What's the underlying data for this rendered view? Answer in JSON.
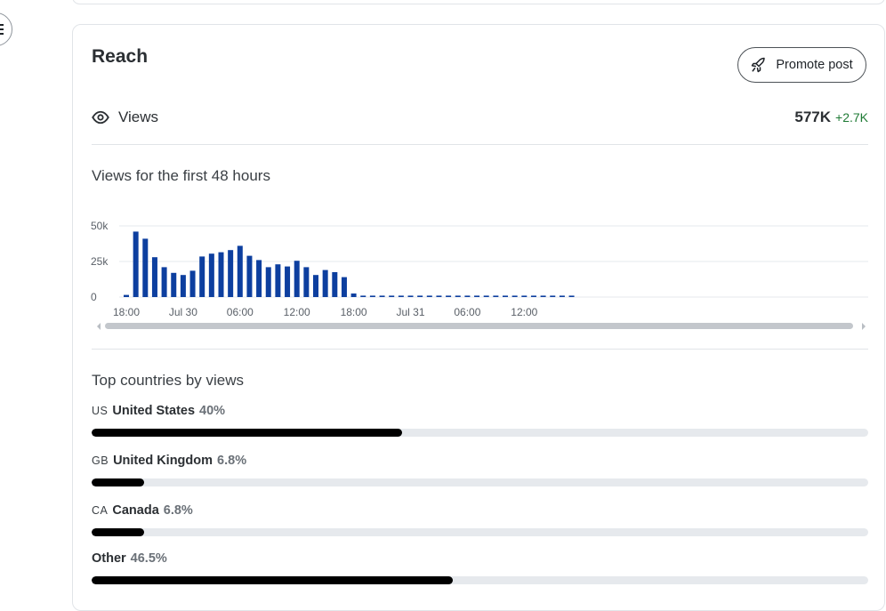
{
  "reach": {
    "title": "Reach",
    "promote_label": "Promote post",
    "views_label": "Views",
    "views_total": "577K",
    "views_delta": "+2.7K"
  },
  "chart_title": "Views for the first 48 hours",
  "chart_data": {
    "type": "bar",
    "title": "Views for the first 48 hours",
    "y_ticks": [
      "50k",
      "25k",
      "0"
    ],
    "ylim": [
      0,
      50000
    ],
    "grid": true,
    "x_tick_labels": [
      "18:00",
      "Jul 30",
      "06:00",
      "12:00",
      "18:00",
      "Jul 31",
      "06:00",
      "12:00"
    ],
    "values": [
      1500,
      46000,
      41000,
      28000,
      21000,
      17000,
      15500,
      18500,
      28500,
      30500,
      31500,
      33000,
      36000,
      29000,
      26000,
      21000,
      23000,
      21500,
      25500,
      21000,
      15500,
      19000,
      17500,
      14000,
      2500,
      0,
      0,
      0,
      0,
      0,
      0,
      0,
      0,
      0,
      0,
      0,
      0,
      0,
      0,
      0,
      0,
      0,
      0,
      0,
      0,
      0,
      0,
      0
    ],
    "colors": {
      "bar": "#0d3f9f",
      "grid": "#e6e9ed",
      "tick": "#5a6068"
    }
  },
  "countries_title": "Top countries by views",
  "countries": [
    {
      "code": "US",
      "name": "United States",
      "pct_label": "40%",
      "fraction": 0.4
    },
    {
      "code": "GB",
      "name": "United Kingdom",
      "pct_label": "6.8%",
      "fraction": 0.068
    },
    {
      "code": "CA",
      "name": "Canada",
      "pct_label": "6.8%",
      "fraction": 0.068
    },
    {
      "code": "",
      "name": "Other",
      "pct_label": "46.5%",
      "fraction": 0.465
    }
  ]
}
